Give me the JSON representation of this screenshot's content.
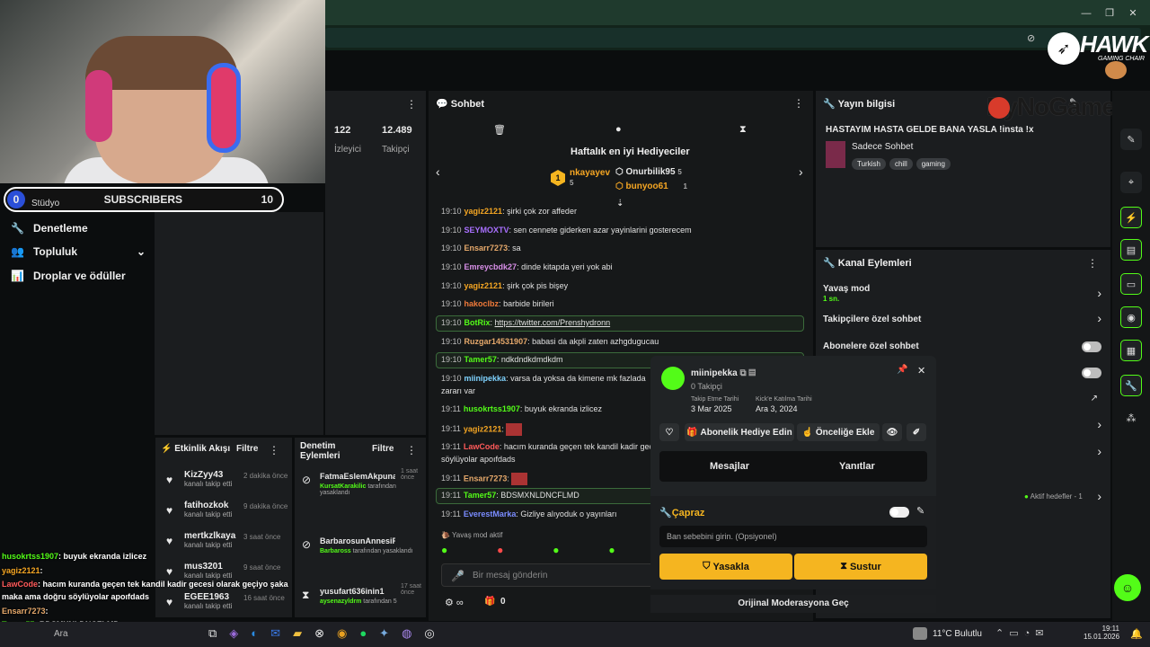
{
  "window": {
    "controls": [
      "—",
      "❐",
      "✕"
    ]
  },
  "logo": {
    "brand": "HAWK",
    "tagline": "GAMING CHAIR"
  },
  "watermark": "ByNoGame",
  "overlay": {
    "sub_count_left": "0",
    "studio": "Stüdyo",
    "subscribers_label": "SUBSCRIBERS",
    "sub_count_right": "10"
  },
  "nav": {
    "items": [
      "Denetleme",
      "Topluluk",
      "Droplar ve ödüller"
    ]
  },
  "stats": {
    "viewers_value": "122",
    "viewers_label": "İzleyici",
    "followers_value": "12.489",
    "followers_label": "Takipçi"
  },
  "chat": {
    "title": "Sohbet",
    "top_gifters_title": "Haftalık en iyi Hediyeciler",
    "gifters": [
      {
        "name": "nkayayev",
        "count": "5"
      },
      {
        "name": "Onurbilik95",
        "count": "5"
      },
      {
        "name": "bunyoo61",
        "count": "1"
      }
    ],
    "rank": "1",
    "messages": [
      {
        "time": "19:10",
        "user": "yagiz2121",
        "text": "şirki çok zor affeder",
        "color": "#f5a623"
      },
      {
        "time": "19:10",
        "user": "SEYMOXTV",
        "text": "sen cennete giderken azar yayinlarini gosterecem",
        "color": "#a970ff"
      },
      {
        "time": "19:10",
        "user": "Ensarr7273",
        "text": "sa",
        "color": "#e6a96b"
      },
      {
        "time": "19:10",
        "user": "Emreycbdk27",
        "text": "dinde kitapda yeri yok abi",
        "color": "#d88fe8"
      },
      {
        "time": "19:10",
        "user": "yagiz2121",
        "text": "şirk çok pis bişey",
        "color": "#f5a623"
      },
      {
        "time": "19:10",
        "user": "hakoclbz",
        "text": "barbide birileri",
        "color": "#f07a3a"
      },
      {
        "time": "19:10",
        "user": "BotRix",
        "text": "https://twitter.com/Prenshydronn",
        "color": "#53fc18"
      },
      {
        "time": "19:10",
        "user": "Ruzgar14531907",
        "text": "babasi da akpli zaten azhgdugucau",
        "color": "#e6a96b"
      },
      {
        "time": "19:10",
        "user": "Tamer57",
        "text": "ndkdndkdmdkdm",
        "color": "#53fc18"
      },
      {
        "time": "19:10",
        "user": "miinipekka",
        "text": "varsa da yoksa da kimene mk fazlada",
        "color": "#7fd3ff"
      },
      {
        "time": "",
        "user": "",
        "text": "zararı var",
        "color": "#ccc"
      },
      {
        "time": "19:11",
        "user": "husokrtss1907",
        "text": "buyuk ekranda izlicez",
        "color": "#53fc18"
      },
      {
        "time": "19:11",
        "user": "yagiz2121",
        "text": "",
        "color": "#f5a623"
      },
      {
        "time": "19:11",
        "user": "LawCode",
        "text": "hacım kuranda geçen tek kandil kadir gecesi olarak geçiyo şaka maka ama doğru",
        "color": "#ff5a5a"
      },
      {
        "time": "",
        "user": "",
        "text": "söylüyolar apoıfdads",
        "color": "#ccc"
      },
      {
        "time": "19:11",
        "user": "Ensarr7273",
        "text": "",
        "color": "#e6a96b"
      },
      {
        "time": "19:11",
        "user": "Tamer57",
        "text": "BDSMXNLDNCFLMD",
        "color": "#53fc18"
      },
      {
        "time": "19:11",
        "user": "EverestMarka",
        "text": "Gizliye alıyoduk o yayınları",
        "color": "#7a8cff"
      }
    ],
    "slow_mode": "Yavaş mod aktif",
    "input_placeholder": "Bir mesaj gönderin",
    "footer_count": "0"
  },
  "stream_info": {
    "title": "Yayın bilgisi",
    "stream_title": "HASTAYIM HASTA GELDE BANA YASLA !insta !x",
    "category": "Sadece Sohbet",
    "tags": [
      "Turkish",
      "chill",
      "gaming"
    ]
  },
  "channel_actions": {
    "title": "Kanal Eylemleri",
    "slow_mode": "Yavaş mod",
    "slow_value": "1 sn.",
    "follower_chat": "Takipçilere özel sohbet",
    "sub_chat": "Abonelere özel sohbet",
    "goals": "Aktif hedefler - 1"
  },
  "events": {
    "title": "Etkinlik Akışı",
    "filter": "Filtre",
    "items": [
      {
        "name": "KizZyy43",
        "time": "2 dakika önce",
        "sub": "kanalı takip etti"
      },
      {
        "name": "fatihozkok",
        "time": "9 dakika önce",
        "sub": "kanalı takip etti"
      },
      {
        "name": "mertkzlkaya",
        "time": "3 saat önce",
        "sub": "kanalı takip etti"
      },
      {
        "name": "mus3201",
        "time": "9 saat önce",
        "sub": "kanalı takip etti"
      },
      {
        "name": "EGEE1963",
        "time": "16 saat önce",
        "sub": "kanalı takip etti"
      }
    ]
  },
  "mod_actions": {
    "title": "Denetim Eylemleri",
    "filter": "Filtre",
    "items": [
      {
        "name": "FatmaEslemAkpunar",
        "time": "1 saat önce",
        "by": "KursatKarakilic",
        "sub": "tarafından yasaklandı"
      },
      {
        "name": "BarbarosunAnnesiPopu",
        "time": "",
        "by": "Barbaross",
        "sub": "tarafından yasaklandı"
      },
      {
        "name": "yusufart636inin1",
        "time": "17 saat önce",
        "by": "aysenazyldrm",
        "sub": "tarafından 5"
      }
    ]
  },
  "user_card": {
    "username": "miinipekka",
    "followers": "0 Takipçi",
    "follow_date_label": "Takip Etme Tarihi",
    "follow_date": "3 Mar 2025",
    "join_date_label": "Kick'e Katılma Tarihi",
    "join_date": "Ara 3, 2024",
    "gift_sub": "Abonelik Hediye Edin",
    "add_priority": "Önceliğe Ekle",
    "tab_messages": "Mesajlar",
    "tab_replies": "Yanıtlar",
    "section": "Çapraz",
    "ban_placeholder": "Ban sebebini girin. (Opsiyonel)",
    "ban": "Yasakla",
    "timeout": "Sustur",
    "original_mod": "Orijinal Moderasyona Geç"
  },
  "stream_overlay_chat": [
    {
      "user": "husokrtss1907",
      "text": ": buyuk ekranda izlicez",
      "color": "#53fc18"
    },
    {
      "user": "yagiz2121",
      "text": ":",
      "color": "#f5a623"
    },
    {
      "user": "LawCode",
      "text": ": hacım kuranda geçen tek kandil kadir gecesi olarak geçiyo şaka",
      "color": "#ff5a5a"
    },
    {
      "user": "",
      "text": "maka ama doğru söylüyolar apoıfdads",
      "color": "#fff"
    },
    {
      "user": "Ensarr7273",
      "text": ":",
      "color": "#e6a96b"
    },
    {
      "user": "Tamer57",
      "text": ": BDSMXNLDNCFLMD",
      "color": "#53fc18"
    },
    {
      "user": "EverestMarka",
      "text": ": Gizliye alıyoduk o yayınları",
      "color": "#7a8cff"
    }
  ],
  "taskbar": {
    "search": "Ara",
    "weather": "11°C  Bulutlu",
    "time": "19:11",
    "date": "15.01.2026"
  }
}
